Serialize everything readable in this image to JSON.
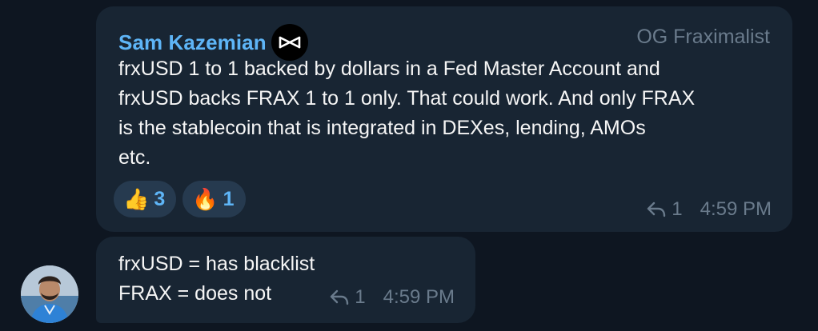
{
  "message1": {
    "sender": "Sam Kazemian",
    "role": "OG Fraximalist",
    "text": "frxUSD 1 to 1 backed by dollars in a Fed Master Account and\nfrxUSD backs FRAX 1 to 1 only. That could work. And only FRAX\nis the stablecoin that is integrated in DEXes, lending, AMOs\netc.",
    "reactions": [
      {
        "emoji": "👍",
        "icon": "thumbs-up-icon",
        "count": "3"
      },
      {
        "emoji": "🔥",
        "icon": "fire-icon",
        "count": "1"
      }
    ],
    "reply_count": "1",
    "time": "4:59 PM"
  },
  "message2": {
    "text": "frxUSD = has blacklist\nFRAX = does not",
    "reply_count": "1",
    "time": "4:59 PM"
  },
  "colors": {
    "background": "#0e1621",
    "bubble": "#182533",
    "sender_name": "#5eb5f7",
    "meta_text": "#6a7b8c",
    "reaction_bg": "#263a4f",
    "reaction_count": "#5eb5f7"
  }
}
